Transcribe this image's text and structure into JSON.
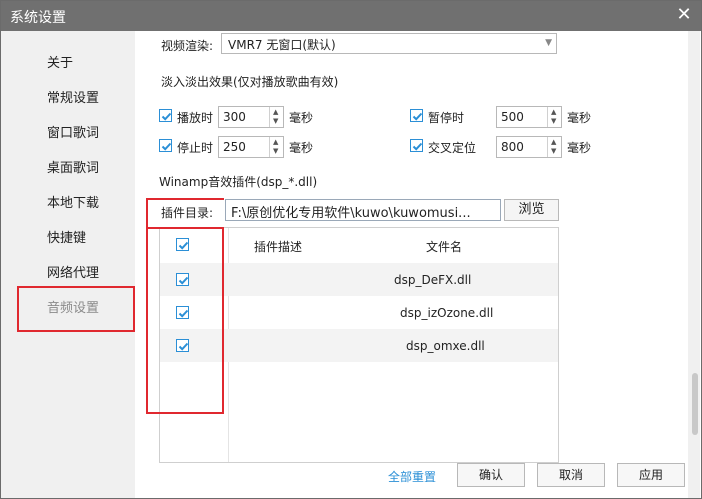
{
  "window": {
    "title": "系统设置"
  },
  "sidebar": {
    "items": [
      {
        "label": "关于"
      },
      {
        "label": "常规设置"
      },
      {
        "label": "窗口歌词"
      },
      {
        "label": "桌面歌词"
      },
      {
        "label": "本地下载"
      },
      {
        "label": "快捷键"
      },
      {
        "label": "网络代理"
      },
      {
        "label": "音频设置",
        "active": true
      }
    ]
  },
  "video_render": {
    "label": "视频渲染:",
    "value": "VMR7 无窗口(默认)"
  },
  "fade": {
    "heading": "淡入淡出效果(仅对播放歌曲有效)",
    "play": {
      "label": "播放时",
      "value": "300",
      "unit": "毫秒",
      "checked": true
    },
    "pause": {
      "label": "暂停时",
      "value": "500",
      "unit": "毫秒",
      "checked": true
    },
    "stop": {
      "label": "停止时",
      "value": "250",
      "unit": "毫秒",
      "checked": true
    },
    "crossfade": {
      "label": "交叉定位",
      "value": "800",
      "unit": "毫秒",
      "checked": true
    }
  },
  "winamp": {
    "heading": "Winamp音效插件(dsp_*.dll)",
    "dir_label": "插件目录:",
    "dir_value": "F:\\原创优化专用软件\\kuwo\\kuwomusi...",
    "browse_label": "浏览"
  },
  "plugin_table": {
    "headers": {
      "desc": "插件描述",
      "file": "文件名"
    },
    "rows": [
      {
        "file": "dsp_DeFX.dll",
        "checked": true
      },
      {
        "file": "dsp_izOzone.dll",
        "checked": true
      },
      {
        "file": "dsp_omxe.dll",
        "checked": true
      }
    ]
  },
  "footer": {
    "reset_label": "全部重置",
    "ok_label": "确认",
    "cancel_label": "取消",
    "apply_label": "应用"
  },
  "colors": {
    "accent": "#2b8fd6",
    "highlight": "#e0282f",
    "titlebar": "#707070"
  }
}
